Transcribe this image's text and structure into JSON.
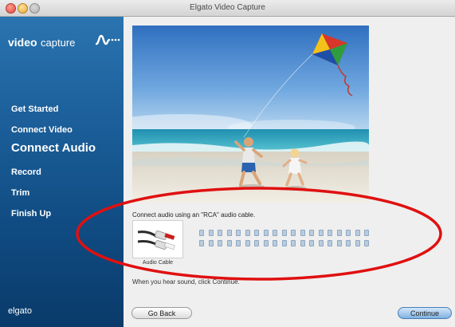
{
  "window": {
    "title": "Elgato Video Capture"
  },
  "sidebar": {
    "logo_bold": "video",
    "logo_light": "capture",
    "brand": "elgato",
    "items": [
      {
        "label": "Get Started",
        "active": false
      },
      {
        "label": "Connect Video",
        "active": false
      },
      {
        "label": "Connect Audio",
        "active": true
      },
      {
        "label": "Record",
        "active": false
      },
      {
        "label": "Trim",
        "active": false
      },
      {
        "label": "Finish Up",
        "active": false
      }
    ]
  },
  "main": {
    "instruction": "Connect audio using an \"RCA\" audio cable.",
    "cable_label": "Audio Cable",
    "hint": "When you hear sound, click Continue.",
    "audio_meter": {
      "rows": 2,
      "columns": 19,
      "level": 0
    }
  },
  "buttons": {
    "back": "Go Back",
    "continue": "Continue"
  },
  "colors": {
    "sidebar_top": "#2a74b0",
    "sidebar_bottom": "#0a3a6a",
    "annotation": "#e01010",
    "continue_button": "#7eb1e2"
  },
  "icons": {
    "logo_wave": "waveform-icon",
    "cable": "rca-cable-icon"
  }
}
